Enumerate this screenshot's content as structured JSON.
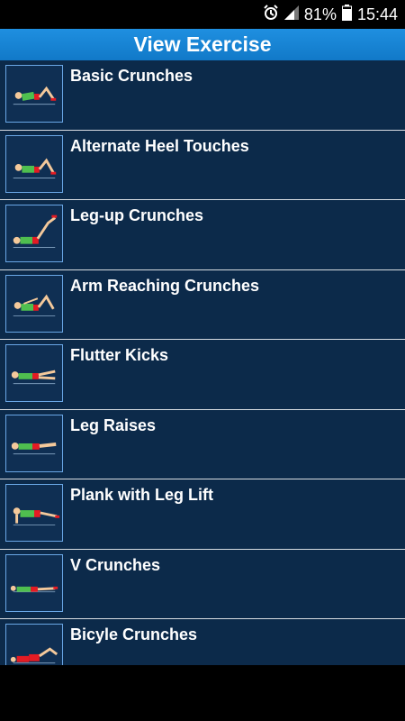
{
  "status": {
    "battery_percent": "81%",
    "time": "15:44",
    "icons": [
      "alarm-icon",
      "signal-icon",
      "battery-icon"
    ]
  },
  "app_bar": {
    "title": "View Exercise"
  },
  "exercises": [
    {
      "name": "Basic Crunches"
    },
    {
      "name": "Alternate Heel Touches"
    },
    {
      "name": "Leg-up Crunches"
    },
    {
      "name": "Arm Reaching Crunches"
    },
    {
      "name": "Flutter Kicks"
    },
    {
      "name": "Leg Raises"
    },
    {
      "name": "Plank with Leg Lift"
    },
    {
      "name": "V Crunches"
    },
    {
      "name": "Bicyle Crunches"
    }
  ],
  "colors": {
    "list_bg": "#0c2a4a",
    "app_bar": "#1584d6",
    "divider": "#d9dde2",
    "thumb_border": "#6aa7e6",
    "shirt": "#4fbf4f",
    "shorts": "#e51b23"
  }
}
